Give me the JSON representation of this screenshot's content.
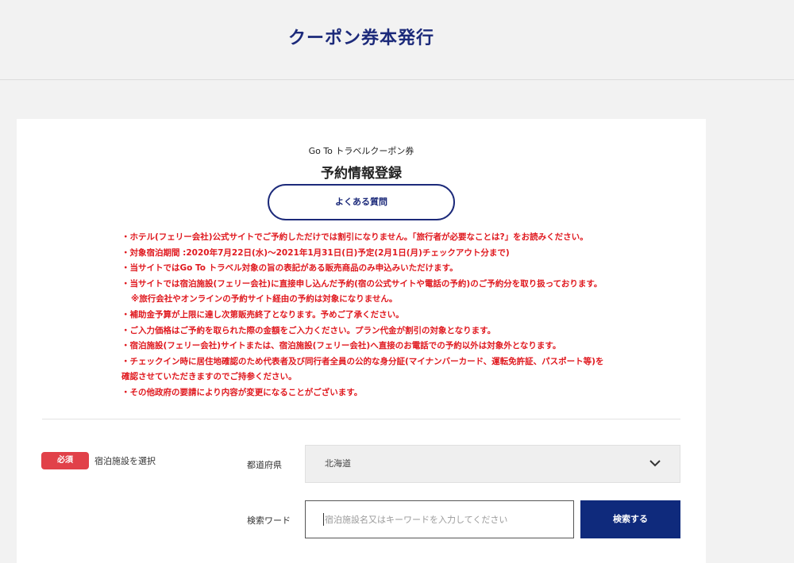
{
  "header": {
    "title": "クーポン券本発行"
  },
  "card": {
    "subtitle": "Go To トラベルクーポン券",
    "form_title": "予約情報登録",
    "faq_label": "よくある質問",
    "notices": [
      "・ホテル(フェリー会社)公式サイトでご予約しただけでは割引になりません。「旅行者が必要なことは?」をお読みください。",
      "・対象宿泊期間 :2020年7月22日(水)〜2021年1月31日(日)予定(2月1日(月)チェックアウト分まで)",
      "・当サイトではGo To トラベル対象の旨の表記がある販売商品のみ申込みいただけます。",
      "・当サイトでは宿泊施設(フェリー会社)に直接申し込んだ予約(宿の公式サイトや電話の予約)のご予約分を取り扱っております。",
      "※旅行会社やオンラインの予約サイト経由の予約は対象になりません。",
      "・補助金予算が上限に達し次第販売終了となります。予めご了承ください。",
      "・ご入力価格はご予約を取られた際の金額をご入力ください。プラン代金が割引の対象となります。",
      "・宿泊施設(フェリー会社)サイトまたは、宿泊施設(フェリー会社)へ直接のお電話での予約以外は対象外となります。",
      "・チェックイン時に居住地確認のため代表者及び同行者全員の公的な身分証(マイナンバーカード、運転免許証、パスポート等)を",
      "確認させていただきますのでご持参ください。",
      "・その他政府の要請により内容が変更になることがございます。"
    ]
  },
  "form": {
    "required_badge": "必須",
    "required_label": "宿泊施設を選択",
    "prefecture_label": "都道府県",
    "prefecture_value": "北海道",
    "search_label": "検索ワード",
    "search_placeholder": "宿泊施設名又はキーワードを入力してください",
    "search_button": "検索する"
  },
  "colors": {
    "brand_navy": "#1c2a7a",
    "button_navy": "#0f2a7c",
    "notice_red": "#e0191f",
    "required_red": "#e14149"
  },
  "icons": {
    "select_arrow": "chevron-down-icon"
  }
}
